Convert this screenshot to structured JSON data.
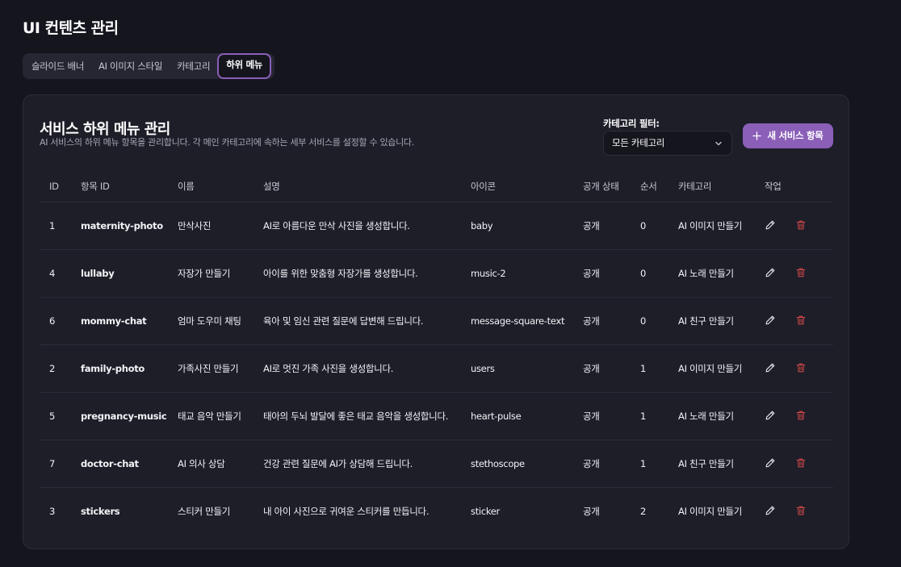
{
  "page": {
    "title": "UI 컨텐츠 관리"
  },
  "tabs": [
    {
      "label": "슬라이드 배너",
      "active": false
    },
    {
      "label": "AI 이미지 스타일",
      "active": false
    },
    {
      "label": "카테고리",
      "active": false
    },
    {
      "label": "하위 메뉴",
      "active": true
    }
  ],
  "card": {
    "title": "서비스 하위 메뉴 관리",
    "description": "AI 서비스의 하위 메뉴 항목을 관리합니다. 각 메인 카테고리에 속하는 세부 서비스를 설정할 수 있습니다.",
    "filter_label": "카테고리 필터:",
    "filter_value": "모든 카테고리",
    "add_button_label": "새 서비스 항목"
  },
  "table": {
    "columns": [
      "ID",
      "항목 ID",
      "이름",
      "설명",
      "아이콘",
      "공개 상태",
      "순서",
      "카테고리",
      "작업"
    ],
    "rows": [
      {
        "id": "1",
        "item_id": "maternity-photo",
        "name": "만삭사진",
        "desc": "AI로 아름다운 만삭 사진을 생성합니다.",
        "icon": "baby",
        "status": "공개",
        "order": "0",
        "category": "AI 이미지 만들기"
      },
      {
        "id": "4",
        "item_id": "lullaby",
        "name": "자장가 만들기",
        "desc": "아이를 위한 맞춤형 자장가를 생성합니다.",
        "icon": "music-2",
        "status": "공개",
        "order": "0",
        "category": "AI 노래 만들기"
      },
      {
        "id": "6",
        "item_id": "mommy-chat",
        "name": "엄마 도우미 채팅",
        "desc": "육아 및 임신 관련 질문에 답변해 드립니다.",
        "icon": "message-square-text",
        "status": "공개",
        "order": "0",
        "category": "AI 친구 만들기"
      },
      {
        "id": "2",
        "item_id": "family-photo",
        "name": "가족사진 만들기",
        "desc": "AI로 멋진 가족 사진을 생성합니다.",
        "icon": "users",
        "status": "공개",
        "order": "1",
        "category": "AI 이미지 만들기"
      },
      {
        "id": "5",
        "item_id": "pregnancy-music",
        "name": "태교 음악 만들기",
        "desc": "태아의 두뇌 발달에 좋은 태교 음악을 생성합니다.",
        "icon": "heart-pulse",
        "status": "공개",
        "order": "1",
        "category": "AI 노래 만들기"
      },
      {
        "id": "7",
        "item_id": "doctor-chat",
        "name": "AI 의사 상담",
        "desc": "건강 관련 질문에 AI가 상담해 드립니다.",
        "icon": "stethoscope",
        "status": "공개",
        "order": "1",
        "category": "AI 친구 만들기"
      },
      {
        "id": "3",
        "item_id": "stickers",
        "name": "스티커 만들기",
        "desc": "내 아이 사진으로 귀여운 스티커를 만듭니다.",
        "icon": "sticker",
        "status": "공개",
        "order": "2",
        "category": "AI 이미지 만들기"
      }
    ]
  },
  "colors": {
    "background": "#15151e",
    "card": "#1e1e29",
    "accent": "#8b5fb8",
    "delete": "#d04848"
  },
  "icons": {
    "edit": "pencil-icon",
    "delete": "trash-icon",
    "add": "plus-icon",
    "dropdown": "chevron-down-icon"
  }
}
